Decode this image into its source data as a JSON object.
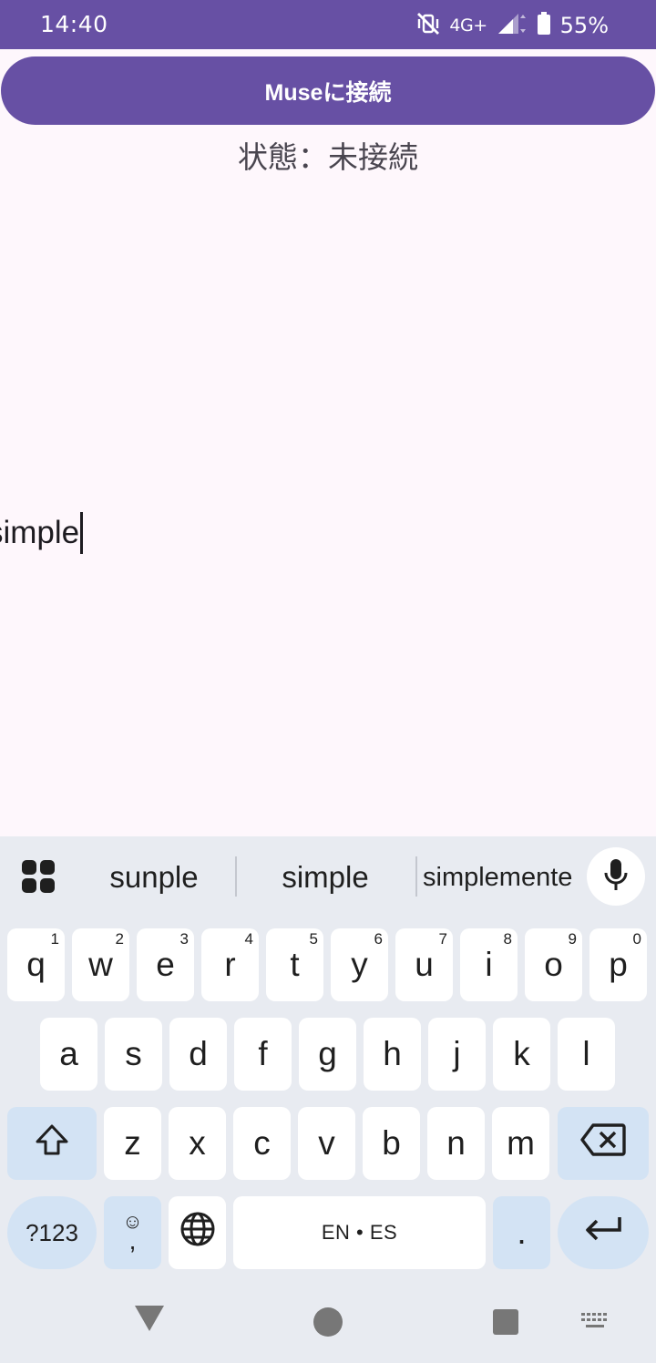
{
  "status_bar": {
    "time": "14:40",
    "network_label": "4G+",
    "battery_percent": "55%",
    "icons": [
      "vibrate-off-icon",
      "signal-icon",
      "battery-icon"
    ]
  },
  "app": {
    "connect_button_label": "Museに接続",
    "status_text": "状態：未接続",
    "input_value": "simple"
  },
  "keyboard": {
    "suggestions": [
      "sunple",
      "simple",
      "simplemente"
    ],
    "row1": [
      {
        "key": "q",
        "hint": "1"
      },
      {
        "key": "w",
        "hint": "2"
      },
      {
        "key": "e",
        "hint": "3"
      },
      {
        "key": "r",
        "hint": "4"
      },
      {
        "key": "t",
        "hint": "5"
      },
      {
        "key": "y",
        "hint": "6"
      },
      {
        "key": "u",
        "hint": "7"
      },
      {
        "key": "i",
        "hint": "8"
      },
      {
        "key": "o",
        "hint": "9"
      },
      {
        "key": "p",
        "hint": "0"
      }
    ],
    "row2": [
      "a",
      "s",
      "d",
      "f",
      "g",
      "h",
      "j",
      "k",
      "l"
    ],
    "row3": [
      "z",
      "x",
      "c",
      "v",
      "b",
      "n",
      "m"
    ],
    "symbols_label": "?123",
    "comma_label": ",",
    "space_label": "EN • ES",
    "period_label": ".",
    "colors": {
      "background": "#e8ebf1",
      "key": "#ffffff",
      "function_key": "#d3e3f4"
    }
  },
  "nav_bar": {
    "icons": [
      "back-icon",
      "home-icon",
      "recents-icon",
      "keyboard-switch-icon"
    ]
  },
  "theme": {
    "primary": "#6750a4",
    "surface": "#fef7fc"
  }
}
